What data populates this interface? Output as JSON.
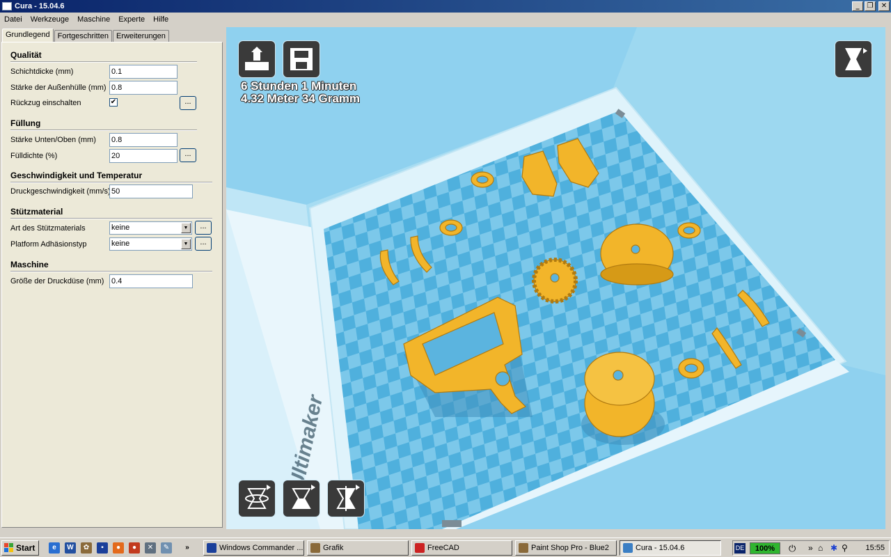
{
  "window": {
    "title": "Cura - 15.04.6"
  },
  "menu": [
    "Datei",
    "Werkzeuge",
    "Maschine",
    "Experte",
    "Hilfe"
  ],
  "tabs": [
    {
      "label": "Grundlegend",
      "active": true
    },
    {
      "label": "Fortgeschritten",
      "active": false
    },
    {
      "label": "Erweiterungen",
      "active": false
    }
  ],
  "sections": {
    "quality": {
      "title": "Qualität",
      "layer_height_label": "Schichtdicke (mm)",
      "layer_height": "0.1",
      "shell_label": "Stärke der Außenhülle (mm)",
      "shell": "0.8",
      "retraction_label": "Rückzug einschalten",
      "retraction_checked": "✔"
    },
    "fill": {
      "title": "Füllung",
      "bottom_top_label": "Stärke Unten/Oben (mm)",
      "bottom_top": "0.8",
      "density_label": "Fülldichte (%)",
      "density": "20"
    },
    "speed": {
      "title": "Geschwindigkeit und Temperatur",
      "print_speed_label": "Druckgeschwindigkeit (mm/s)",
      "print_speed": "50"
    },
    "support": {
      "title": "Stützmaterial",
      "type_label": "Art des Stützmaterials",
      "type": "keine",
      "adhesion_label": "Platform Adhäsionstyp",
      "adhesion": "keine"
    },
    "machine": {
      "title": "Maschine",
      "nozzle_label": "Größe der Druckdüse (mm)",
      "nozzle": "0.4"
    }
  },
  "dots_label": "...",
  "viewport": {
    "print_time": "6 Stunden 1 Minuten",
    "print_material": "4.32 Meter 34 Gramm",
    "brand_text": "Ultimaker",
    "colors": {
      "background": "#8fd1ef",
      "bed": "#5bb4df",
      "model": "#f2b52a"
    }
  },
  "taskbar": {
    "start": "Start",
    "tasks": [
      {
        "label": "Windows Commander ...",
        "active": false
      },
      {
        "label": "Grafik",
        "active": false
      },
      {
        "label": "FreeCAD",
        "active": false
      },
      {
        "label": "Paint Shop Pro - Blue2",
        "active": false
      },
      {
        "label": "Cura - 15.04.6",
        "active": true
      }
    ],
    "lang": "DE",
    "battery": "100%",
    "clock": "15:55",
    "more": "»"
  }
}
